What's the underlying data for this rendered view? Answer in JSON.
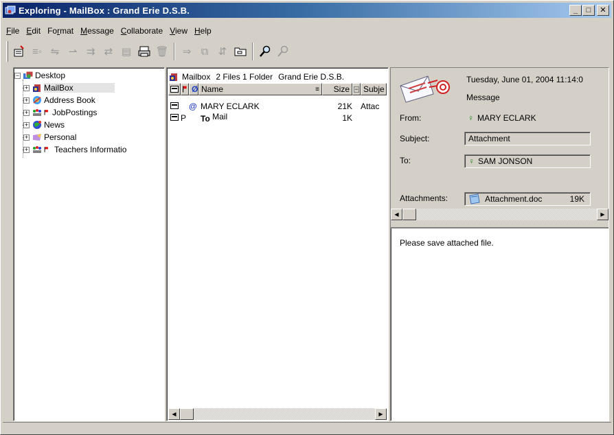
{
  "window": {
    "title": "Exploring - MailBox : Grand Erie D.S.B.",
    "minimize": "_",
    "maximize": "□",
    "close": "✕"
  },
  "menu": [
    {
      "label": "File",
      "acc": "F",
      "rest": "ile"
    },
    {
      "label": "Edit",
      "acc": "E",
      "rest": "dit"
    },
    {
      "label": "Format",
      "pre": "Fo",
      "acc": "r",
      "rest": "mat"
    },
    {
      "label": "Message",
      "acc": "M",
      "rest": "essage"
    },
    {
      "label": "Collaborate",
      "acc": "C",
      "rest": "ollaborate"
    },
    {
      "label": "View",
      "acc": "V",
      "rest": "iew"
    },
    {
      "label": "Help",
      "acc": "H",
      "rest": "elp"
    }
  ],
  "toolbar": {
    "icons": [
      "new-message-icon",
      "reply-icon",
      "reply-all-icon",
      "forward-icon",
      "forward-attach-icon",
      "resend-icon",
      "save-icon",
      "print-icon",
      "delete-icon",
      "move-icon",
      "copy-icon",
      "sort-icon",
      "folder-icon",
      "find-icon",
      "tools-icon"
    ]
  },
  "tree": {
    "root": "Desktop",
    "items": [
      {
        "label": "MailBox",
        "icon": "mailbox-icon",
        "selected": true
      },
      {
        "label": "Address Book",
        "icon": "address-book-icon"
      },
      {
        "label": "JobPostings",
        "icon": "group-flag-icon"
      },
      {
        "label": "News",
        "icon": "news-globe-icon"
      },
      {
        "label": "Personal",
        "icon": "personal-folder-icon"
      },
      {
        "label": "Teachers Informatio",
        "icon": "group-flag-icon"
      }
    ]
  },
  "list": {
    "location": "Mailbox",
    "summary": "2 Files 1 Folder",
    "org": "Grand Erie D.S.B.",
    "columns": {
      "name": "Name",
      "size": "Size",
      "subject": "Subje"
    },
    "rows": [
      {
        "flag": "",
        "attach": "@",
        "name": "MARY ECLARK",
        "size": "21K",
        "subject": "Attac"
      },
      {
        "flag": "P",
        "attach": "",
        "name_prefix": "To",
        "name": "Mail",
        "size": "1K",
        "subject": ""
      }
    ]
  },
  "preview": {
    "date": "Tuesday, June 01, 2004 11:14:0",
    "type": "Message",
    "from_label": "From:",
    "from": "MARY ECLARK",
    "subject_label": "Subject:",
    "subject": "Attachment",
    "to_label": "To:",
    "to": "SAM JONSON",
    "attachments_label": "Attachments:",
    "attachment_name": "Attachment.doc",
    "attachment_size": "19K",
    "body": "Please save attached file."
  },
  "colors": {
    "title_start": "#0a246a",
    "title_end": "#a6caf0",
    "chrome": "#d4d0c8",
    "flag_red": "#e01010"
  }
}
